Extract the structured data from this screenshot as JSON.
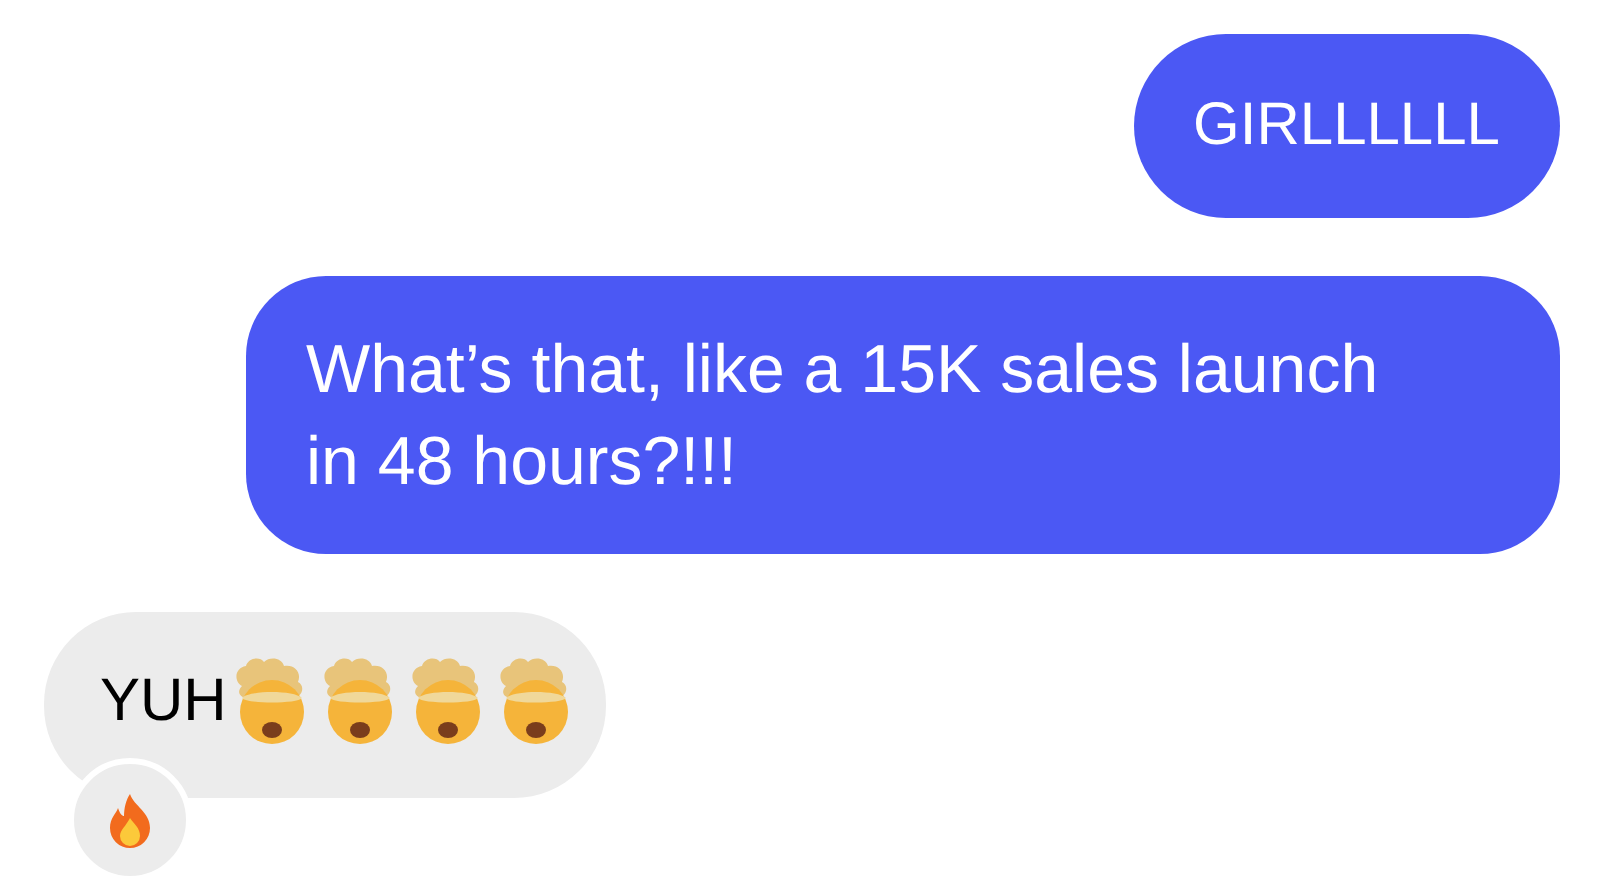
{
  "messages": [
    {
      "kind": "outgoing",
      "text": "GIRLLLLLL",
      "reacted": false
    },
    {
      "kind": "outgoing",
      "text": "What’s that, like a 15K sales launch in 48 hours?!!!",
      "reacted": false
    },
    {
      "kind": "incoming",
      "text": "YUH",
      "reacted": true
    }
  ]
}
